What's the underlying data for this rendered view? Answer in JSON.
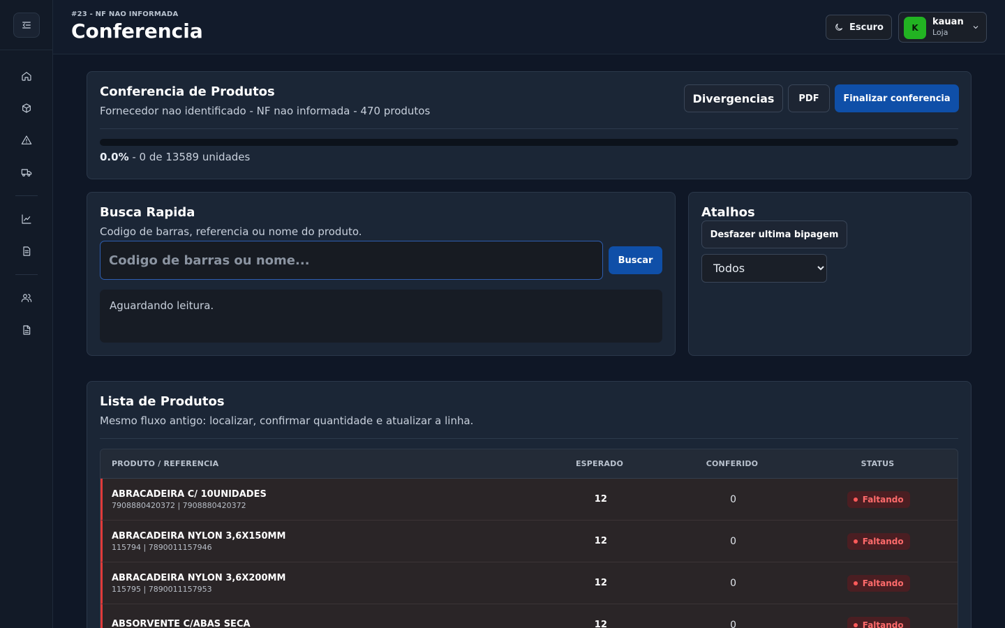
{
  "header": {
    "subtitle": "#23 - NF NAO INFORMADA",
    "title": "Conferencia",
    "theme_label": "Escuro",
    "user": {
      "initial": "K",
      "name": "kauan",
      "role": "Loja"
    }
  },
  "sidebar": {
    "items": [
      "home-icon",
      "package-icon",
      "alert-triangle-icon",
      "truck-icon",
      "chart-icon",
      "file-icon",
      "users-icon",
      "document-icon"
    ]
  },
  "summary": {
    "title": "Conferencia de Produtos",
    "subtitle": "Fornecedor nao identificado - NF nao informada - 470 produtos",
    "divergencias_label": "Divergencias",
    "pdf_label": "PDF",
    "finalize_label": "Finalizar conferencia",
    "progress_percent": "0.0%",
    "progress_detail": " - 0 de 13589 unidades",
    "progress_fraction": 0.0
  },
  "search": {
    "title": "Busca Rapida",
    "subtitle": "Codigo de barras, referencia ou nome do produto.",
    "placeholder": "Codigo de barras ou nome...",
    "button_label": "Buscar",
    "status": "Aguardando leitura."
  },
  "shortcuts": {
    "title": "Atalhos",
    "undo_label": "Desfazer ultima bipagem",
    "filter_selected": "Todos"
  },
  "products": {
    "title": "Lista de Produtos",
    "subtitle": "Mesmo fluxo antigo: localizar, confirmar quantidade e atualizar a linha.",
    "columns": {
      "product": "PRODUTO / REFERENCIA",
      "expected": "ESPERADO",
      "checked": "CONFERIDO",
      "status": "STATUS"
    },
    "rows": [
      {
        "name": "ABRACADEIRA C/ 10UNIDADES",
        "ref": "7908880420372 | 7908880420372",
        "expected": "12",
        "checked": "0",
        "status": "Faltando"
      },
      {
        "name": "ABRACADEIRA NYLON 3,6X150MM",
        "ref": "115794 | 7890011157946",
        "expected": "12",
        "checked": "0",
        "status": "Faltando"
      },
      {
        "name": "ABRACADEIRA NYLON 3,6X200MM",
        "ref": "115795 | 7890011157953",
        "expected": "12",
        "checked": "0",
        "status": "Faltando"
      },
      {
        "name": "ABSORVENTE C/ABAS SECA",
        "ref": "",
        "expected": "12",
        "checked": "0",
        "status": "Faltando"
      }
    ]
  }
}
